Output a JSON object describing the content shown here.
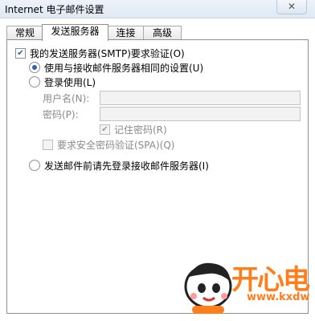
{
  "window": {
    "title": "Internet 电子邮件设置",
    "close_label": "✕"
  },
  "tabs": [
    {
      "label": "常规",
      "active": false
    },
    {
      "label": "发送服务器",
      "active": true
    },
    {
      "label": "连接",
      "active": false
    },
    {
      "label": "高级",
      "active": false
    }
  ],
  "outgoing": {
    "smtp_auth": {
      "label": "我的发送服务器(SMTP)要求验证(O)",
      "checked": true
    },
    "same_as_incoming": {
      "label": "使用与接收邮件服务器相同的设置(U)",
      "selected": true
    },
    "login_using": {
      "label": "登录使用(L)",
      "selected": false
    },
    "username": {
      "label": "用户名(N):",
      "value": ""
    },
    "password": {
      "label": "密码(P):",
      "value": ""
    },
    "remember_password": {
      "label": "记住密码(R)",
      "checked": true,
      "enabled": false
    },
    "spa": {
      "label": "要求安全密码验证(SPA)(Q)",
      "checked": false,
      "enabled": false
    },
    "login_before_send": {
      "label": "发送邮件前请先登录接收邮件服务器(I)",
      "selected": false
    }
  },
  "watermark": {
    "brand": "开心电",
    "url": "www.kxdw"
  }
}
